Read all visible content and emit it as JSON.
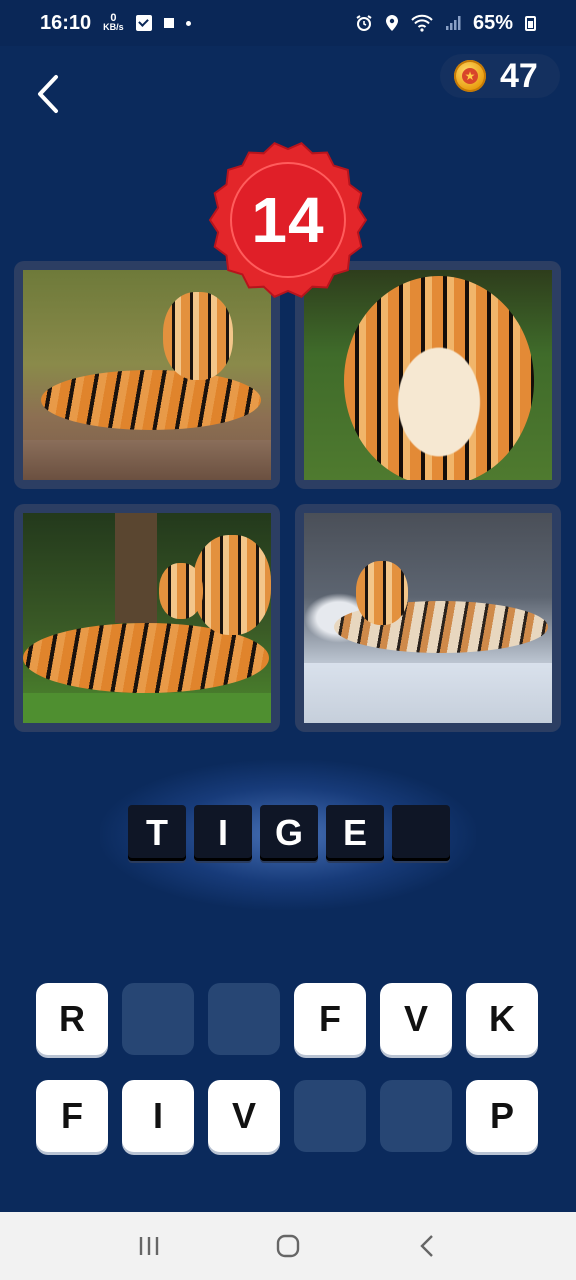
{
  "status": {
    "time": "16:10",
    "net_speed_value": "0",
    "net_speed_unit": "KB/s",
    "battery": "65%",
    "icons": [
      "checkbox-icon",
      "stop-icon",
      "dot-icon",
      "alarm-icon",
      "location-icon",
      "wifi-icon",
      "signal-icon",
      "battery-icon"
    ]
  },
  "header": {
    "back_icon": "chevron-left-icon",
    "coin_icon": "coin-icon",
    "coins": "47"
  },
  "level": {
    "number": "14",
    "badge_color": "#e3262a"
  },
  "pictures": [
    {
      "subject": "tiger lying on grass"
    },
    {
      "subject": "tiger face close-up"
    },
    {
      "subject": "tiger with cub"
    },
    {
      "subject": "tiger lying on snow"
    }
  ],
  "answer": {
    "slots": [
      "T",
      "I",
      "G",
      "E",
      ""
    ]
  },
  "letters": {
    "row1": [
      "R",
      "",
      "",
      "F",
      "V",
      "K"
    ],
    "row2": [
      "F",
      "I",
      "V",
      "",
      "",
      "P"
    ]
  },
  "colors": {
    "background": "#0b2a5c",
    "slot": "#0f1626",
    "key": "#ffffff",
    "empty_key": "#274674"
  },
  "navbar": {
    "icons": [
      "recent-apps-icon",
      "home-icon",
      "back-icon"
    ]
  }
}
